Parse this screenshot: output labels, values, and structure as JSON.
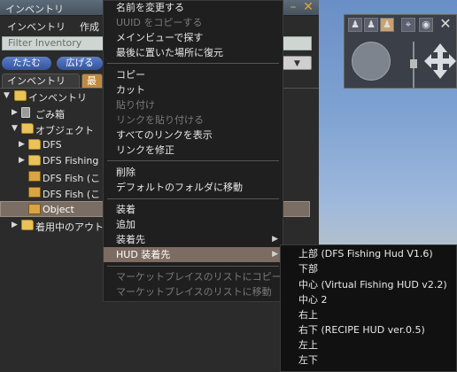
{
  "inventory": {
    "title": "インベントリ",
    "menu": [
      "インベントリ",
      "作成"
    ],
    "filter_placeholder": "Filter Inventory",
    "buttons": {
      "collapse": "たたむ",
      "expand": "広げる"
    },
    "tabs": [
      "インベントリ",
      "最"
    ],
    "items": [
      {
        "label": "インベントリ",
        "icon": "folder-open-icon"
      },
      {
        "label": "ごみ箱",
        "icon": "trash-icon"
      },
      {
        "label": "オブジェクト",
        "icon": "object-folder-icon"
      },
      {
        "label": "DFS",
        "icon": "folder-icon"
      },
      {
        "label": "DFS Fishing",
        "icon": "folder-icon"
      },
      {
        "label": "DFS Fish  (こ",
        "icon": "box-icon"
      },
      {
        "label": "DFS Fish  (こ",
        "icon": "box-icon"
      },
      {
        "label": "Object",
        "icon": "box-icon"
      },
      {
        "label": "着用中のアウト",
        "icon": "outfit-folder-icon"
      }
    ]
  },
  "context_menu": [
    {
      "label": "名前を変更する",
      "disabled": false
    },
    {
      "label": "UUID をコピーする",
      "disabled": true
    },
    {
      "label": "メインビューで探す",
      "disabled": false
    },
    {
      "label": "最後に置いた場所に復元",
      "disabled": false
    },
    {
      "label": "コピー",
      "disabled": false
    },
    {
      "label": "カット",
      "disabled": false
    },
    {
      "label": "貼り付け",
      "disabled": true
    },
    {
      "label": "リンクを貼り付ける",
      "disabled": true
    },
    {
      "label": "すべてのリンクを表示",
      "disabled": false
    },
    {
      "label": "リンクを修正",
      "disabled": false
    },
    {
      "label": "削除",
      "disabled": false
    },
    {
      "label": "デフォルトのフォルダに移動",
      "disabled": false
    },
    {
      "label": "装着",
      "disabled": false
    },
    {
      "label": "追加",
      "disabled": false
    },
    {
      "label": "装着先",
      "disabled": false,
      "submenu": true
    },
    {
      "label": "HUD 装着先",
      "disabled": false,
      "submenu": true,
      "highlighted": true
    },
    {
      "label": "マーケットプレイスのリストにコピー",
      "disabled": true
    },
    {
      "label": "マーケットプレイスのリストに移動",
      "disabled": true
    }
  ],
  "hud_submenu": [
    "上部  (DFS Fishing Hud V1.6)",
    "下部",
    "中心  (Virtual Fishing HUD v2.2)",
    "中心 2",
    "右上",
    "右下  (RECIPE HUD ver.0.5)",
    "左上",
    "左下"
  ],
  "colors": {
    "highlight": "#7d6c62",
    "accent": "#c08a3e",
    "pill": "#3f5fb0"
  }
}
